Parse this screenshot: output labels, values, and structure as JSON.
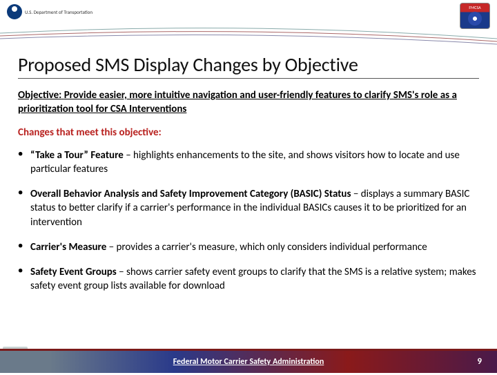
{
  "header": {
    "dot_label": "U.S. Department of Transportation",
    "fmcsa_label": "FMCSA"
  },
  "title": "Proposed SMS Display Changes by Objective",
  "objective_label": "Objective:",
  "objective_text": "Provide easier, more intuitive navigation and user-friendly features to clarify SMS's role as a prioritization tool for CSA Interventions",
  "changes_label": "Changes that meet this objective:",
  "bullets": [
    {
      "bold": "“Take a Tour” Feature",
      "rest": " – highlights enhancements to the site, and shows visitors how to locate and use particular features"
    },
    {
      "bold": "Overall Behavior Analysis and Safety Improvement Category (BASIC) Status",
      "rest": " − displays a summary BASIC status to better clarify if a carrier's performance in the individual BASICs causes it to be prioritized for an intervention"
    },
    {
      "bold": "Carrier's Measure",
      "rest": " − provides a carrier's measure, which only considers individual performance"
    },
    {
      "bold": "Safety Event Groups",
      "rest": " − shows carrier safety event groups to clarify that the SMS is a relative system; makes safety event group lists available for download"
    }
  ],
  "footer": {
    "org": "Federal Motor Carrier Safety Administration",
    "page": "9"
  }
}
